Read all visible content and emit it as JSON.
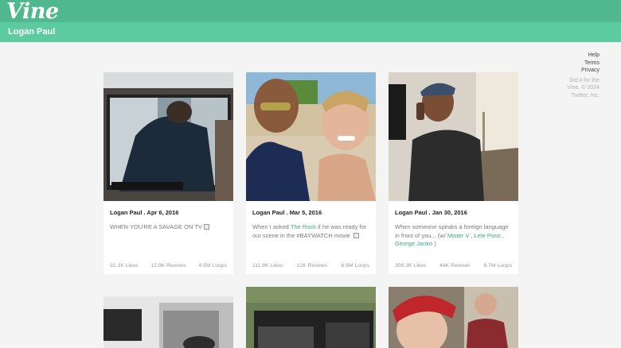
{
  "app": {
    "logo": "Vine",
    "profile_name": "Logan Paul"
  },
  "sidebar": {
    "links": [
      "Help",
      "Terms",
      "Privacy"
    ],
    "copyright": "Did it for the Vine. © 2024 Twitter, Inc."
  },
  "posts": [
    {
      "author": "Logan Paul",
      "date": "Apr 6, 2016",
      "text": "WHEN YOU'RE A SAVAGE ON TV",
      "likes": "92.1K Likes",
      "revines": "12.9K Revines",
      "loops": "4.5M Loops"
    },
    {
      "author": "Logan Paul",
      "date": "Mar 5, 2016",
      "text_a": "When I asked ",
      "mention": "The Rock",
      "text_b": " if he was ready for our scene in the #BAYWATCH movie",
      "likes": "111.8K Likes",
      "revines": "12K Revines",
      "loops": "6.5M Loops"
    },
    {
      "author": "Logan Paul",
      "date": "Jan 30, 2016",
      "text_a": "When someone speaks a foreign language in front of you... (w/ ",
      "mention1": "Mister V",
      "sep1": " , ",
      "mention2": "Lele Pons",
      "sep2": " , ",
      "mention3": "George Janko",
      "text_b": " )",
      "likes": "208.3K Likes",
      "revines": "44K Revines",
      "loops": "8.7M Loops"
    }
  ],
  "colors": {
    "header": "#4fb88f",
    "subheader": "#5ccb9f",
    "link": "#3aa980"
  }
}
